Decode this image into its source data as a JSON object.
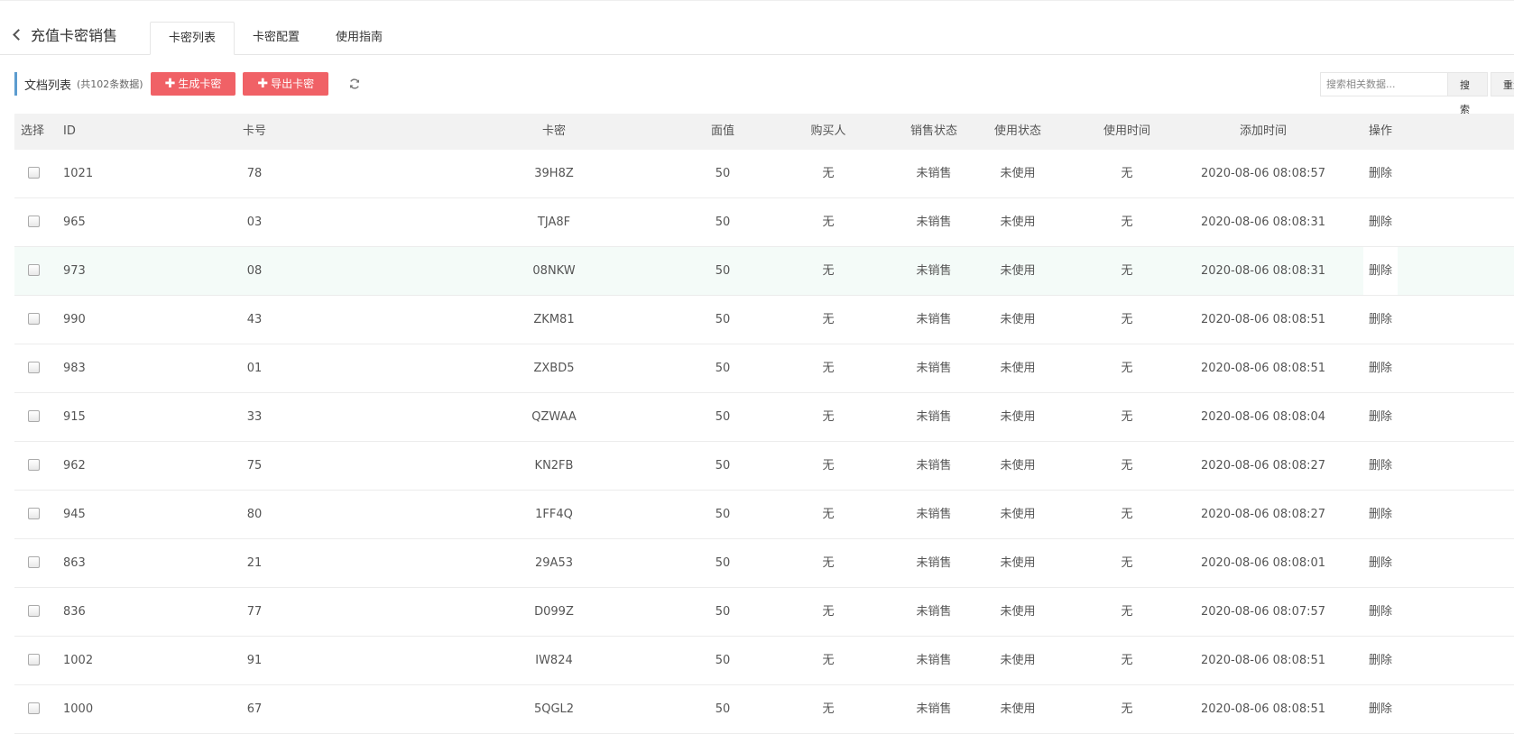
{
  "header": {
    "back_label": "充值卡密销售",
    "tabs": [
      {
        "label": "卡密列表",
        "active": true
      },
      {
        "label": "卡密配置",
        "active": false
      },
      {
        "label": "使用指南",
        "active": false
      }
    ]
  },
  "toolbar": {
    "title": "文档列表",
    "count": "(共102条数据)",
    "generate_label": "生成卡密",
    "export_label": "导出卡密",
    "refresh_icon": "refresh-icon"
  },
  "search": {
    "placeholder": "搜索相关数据...",
    "search_label": "搜索",
    "reset_label": "重置"
  },
  "table": {
    "columns": [
      "选择",
      "ID",
      "卡号",
      "卡密",
      "面值",
      "购买人",
      "销售状态",
      "使用状态",
      "使用时间",
      "添加时间",
      "操作"
    ],
    "rows": [
      {
        "id": "1021",
        "card_no": "78",
        "secret": "39H8Z",
        "value": "50",
        "buyer": "无",
        "sale_status": "未销售",
        "use_status": "未使用",
        "use_time": "无",
        "added": "2020-08-06 08:08:57",
        "action": "删除"
      },
      {
        "id": "965",
        "card_no": "03",
        "secret": "TJA8F",
        "value": "50",
        "buyer": "无",
        "sale_status": "未销售",
        "use_status": "未使用",
        "use_time": "无",
        "added": "2020-08-06 08:08:31",
        "action": "删除"
      },
      {
        "id": "973",
        "card_no": "08",
        "secret": "08NKW",
        "value": "50",
        "buyer": "无",
        "sale_status": "未销售",
        "use_status": "未使用",
        "use_time": "无",
        "added": "2020-08-06 08:08:31",
        "action": "删除"
      },
      {
        "id": "990",
        "card_no": "43",
        "secret": "ZKM81",
        "value": "50",
        "buyer": "无",
        "sale_status": "未销售",
        "use_status": "未使用",
        "use_time": "无",
        "added": "2020-08-06 08:08:51",
        "action": "删除"
      },
      {
        "id": "983",
        "card_no": "01",
        "secret": "ZXBD5",
        "value": "50",
        "buyer": "无",
        "sale_status": "未销售",
        "use_status": "未使用",
        "use_time": "无",
        "added": "2020-08-06 08:08:51",
        "action": "删除"
      },
      {
        "id": "915",
        "card_no": "33",
        "secret": "QZWAA",
        "value": "50",
        "buyer": "无",
        "sale_status": "未销售",
        "use_status": "未使用",
        "use_time": "无",
        "added": "2020-08-06 08:08:04",
        "action": "删除"
      },
      {
        "id": "962",
        "card_no": "75",
        "secret": "KN2FB",
        "value": "50",
        "buyer": "无",
        "sale_status": "未销售",
        "use_status": "未使用",
        "use_time": "无",
        "added": "2020-08-06 08:08:27",
        "action": "删除"
      },
      {
        "id": "945",
        "card_no": "80",
        "secret": "1FF4Q",
        "value": "50",
        "buyer": "无",
        "sale_status": "未销售",
        "use_status": "未使用",
        "use_time": "无",
        "added": "2020-08-06 08:08:27",
        "action": "删除"
      },
      {
        "id": "863",
        "card_no": "21",
        "secret": "29A53",
        "value": "50",
        "buyer": "无",
        "sale_status": "未销售",
        "use_status": "未使用",
        "use_time": "无",
        "added": "2020-08-06 08:08:01",
        "action": "删除"
      },
      {
        "id": "836",
        "card_no": "77",
        "secret": "D099Z",
        "value": "50",
        "buyer": "无",
        "sale_status": "未销售",
        "use_status": "未使用",
        "use_time": "无",
        "added": "2020-08-06 08:07:57",
        "action": "删除"
      },
      {
        "id": "1002",
        "card_no": "91",
        "secret": "IW824",
        "value": "50",
        "buyer": "无",
        "sale_status": "未销售",
        "use_status": "未使用",
        "use_time": "无",
        "added": "2020-08-06 08:08:51",
        "action": "删除"
      },
      {
        "id": "1000",
        "card_no": "67",
        "secret": "5QGL2",
        "value": "50",
        "buyer": "无",
        "sale_status": "未销售",
        "use_status": "未使用",
        "use_time": "无",
        "added": "2020-08-06 08:08:51",
        "action": "删除"
      }
    ]
  },
  "colors": {
    "accent_red": "#f06166",
    "title_bar": "#5c9ccf",
    "header_bg": "#f2f2f2",
    "hover_row": "#f4fbf8"
  }
}
